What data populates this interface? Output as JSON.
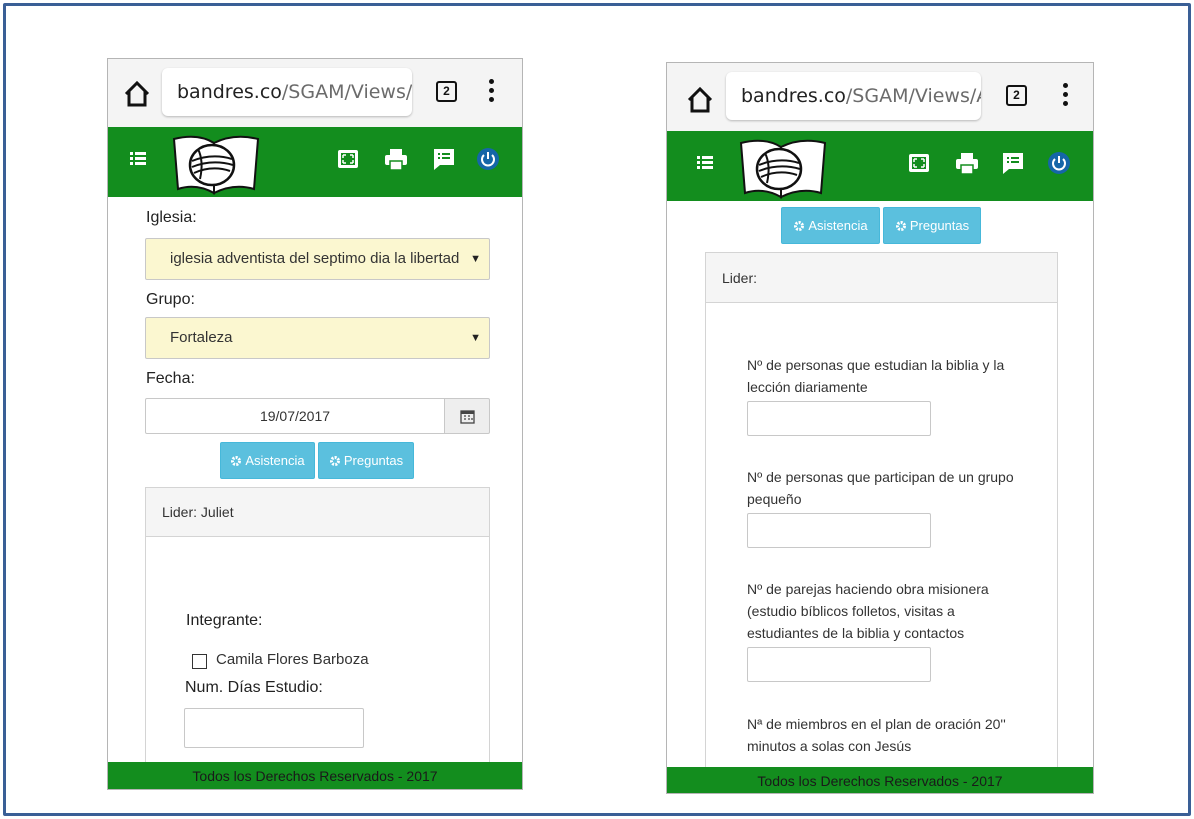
{
  "browser": {
    "url_host": "bandres.co",
    "url_path": "/SGAM/Views/A",
    "tab_count": "2"
  },
  "left": {
    "iglesia_label": "Iglesia:",
    "iglesia_value": "iglesia adventista del septimo dia la libertad",
    "grupo_label": "Grupo:",
    "grupo_value": "Fortaleza",
    "fecha_label": "Fecha:",
    "fecha_value": "19/07/2017",
    "asistencia_button": "Asistencia",
    "preguntas_button": "Preguntas",
    "panel_title": "Lider: Juliet",
    "integrante_label": "Integrante:",
    "member_name": "Camila Flores Barboza",
    "dias_label": "Num. Días Estudio:"
  },
  "right": {
    "asistencia_button": "Asistencia",
    "preguntas_button": "Preguntas",
    "panel_title": "Lider:",
    "questions": [
      "Nº de personas que estudian la biblia y la lección diariamente",
      "Nº de personas que participan de un grupo pequeño",
      "Nº de parejas haciendo obra misionera (estudio bíblicos folletos, visitas a estudiantes de la biblia y contactos",
      "Nª de miembros en el plan de oración 20'' minutos a solas con Jesús"
    ]
  },
  "footer": "Todos los Derechos Reservados - 2017",
  "colors": {
    "appbar": "#138d1e",
    "button": "#5bc0de",
    "select_bg": "#fbf7d0",
    "frame_border": "#3a5f96"
  },
  "icons": [
    "home-icon",
    "tab-switcher-icon",
    "kebab-menu-icon",
    "list-menu-icon",
    "logo-book-icon",
    "fullscreen-icon",
    "print-icon",
    "message-icon",
    "power-icon",
    "calendar-icon",
    "gear-icon",
    "checkbox-icon"
  ]
}
